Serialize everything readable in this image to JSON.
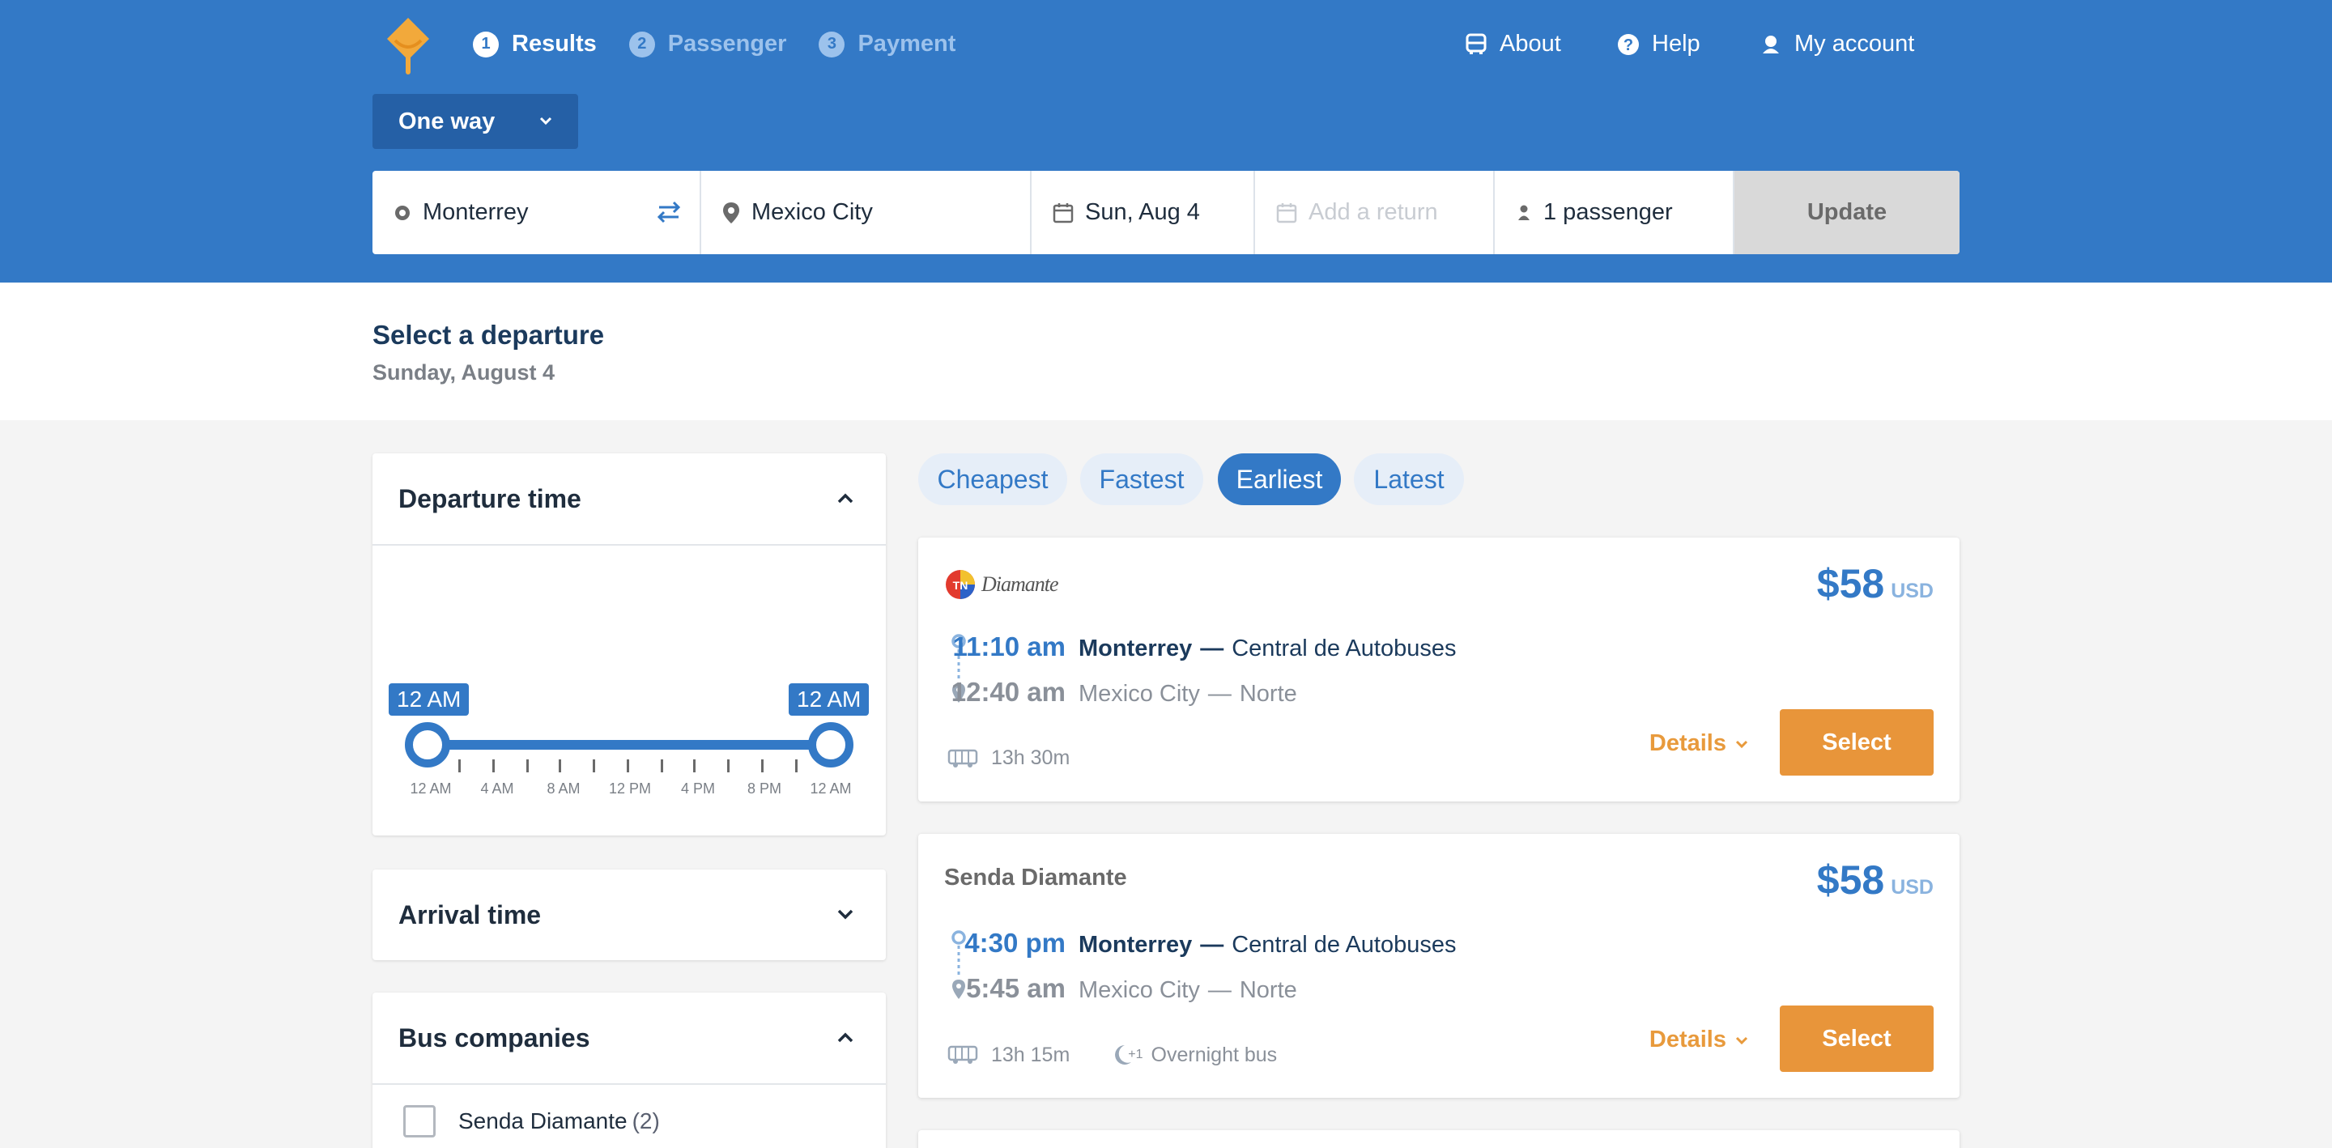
{
  "header": {
    "steps": [
      {
        "num": "1",
        "label": "Results"
      },
      {
        "num": "2",
        "label": "Passenger"
      },
      {
        "num": "3",
        "label": "Payment"
      }
    ],
    "nav": {
      "about": "About",
      "help": "Help",
      "account": "My account"
    },
    "trip_type": "One way",
    "search": {
      "origin": "Monterrey",
      "destination": "Mexico City",
      "date": "Sun, Aug 4",
      "return_placeholder": "Add a return",
      "passengers": "1 passenger",
      "update": "Update"
    }
  },
  "subheader": {
    "title": "Select a departure",
    "date": "Sunday, August 4"
  },
  "filters": {
    "departure": {
      "title": "Departure time",
      "min_label": "12 AM",
      "max_label": "12 AM",
      "ticks": [
        "12 AM",
        "4 AM",
        "8 AM",
        "12 PM",
        "4 PM",
        "8 PM",
        "12 AM"
      ],
      "range": [
        0,
        24
      ]
    },
    "arrival": {
      "title": "Arrival time"
    },
    "companies": {
      "title": "Bus companies",
      "items": [
        {
          "name": "Senda Diamante",
          "count": "(2)"
        }
      ]
    }
  },
  "sort": {
    "options": [
      "Cheapest",
      "Fastest",
      "Earliest",
      "Latest"
    ],
    "active": "Earliest"
  },
  "results": [
    {
      "carrier_logo_text": "Diamante",
      "price": "$58",
      "currency": "USD",
      "dep_time": "11:10 am",
      "dep_city": "Monterrey",
      "dep_terminal": "Central de Autobuses",
      "arr_time": "12:40 am",
      "arr_city": "Mexico City",
      "arr_terminal": "Norte",
      "duration": "13h 30m",
      "details": "Details",
      "select": "Select"
    },
    {
      "carrier_name": "Senda Diamante",
      "price": "$58",
      "currency": "USD",
      "dep_time": "4:30 pm",
      "dep_city": "Monterrey",
      "dep_terminal": "Central de Autobuses",
      "arr_time": "5:45 am",
      "arr_city": "Mexico City",
      "arr_terminal": "Norte",
      "duration": "13h 15m",
      "overnight_sup": "+1",
      "overnight": "Overnight bus",
      "details": "Details",
      "select": "Select"
    }
  ],
  "colors": {
    "brand_blue": "#3379c6",
    "accent_orange": "#e8953a",
    "logo_yellow": "#f2a93b"
  }
}
